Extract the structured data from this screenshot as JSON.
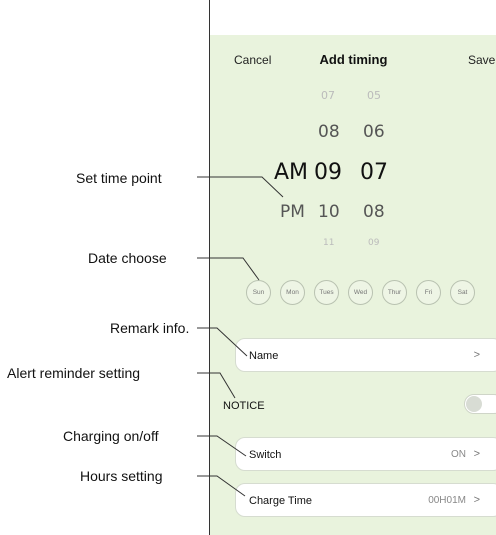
{
  "callouts": {
    "set_time_point": "Set time point",
    "date_choose": "Date choose",
    "remark_info": "Remark info.",
    "alert_reminder": "Alert reminder setting",
    "charging_onoff": "Charging on/off",
    "hours_setting": "Hours setting"
  },
  "header": {
    "cancel": "Cancel",
    "title": "Add timing",
    "save": "Save"
  },
  "picker": {
    "hours": [
      "07",
      "08",
      "09",
      "10",
      "11"
    ],
    "minutes": [
      "05",
      "06",
      "07",
      "08",
      "09"
    ],
    "periods": [
      "AM",
      "PM"
    ],
    "selected_period": "AM",
    "selected_hour": "09",
    "selected_minute": "07"
  },
  "days": [
    "Sun",
    "Mon",
    "Tues",
    "Wed",
    "Thur",
    "Fri",
    "Sat"
  ],
  "rows": {
    "name": {
      "label": "Name",
      "chevron": ">"
    },
    "notice": {
      "label": "NOTICE",
      "toggle_on": false
    },
    "switch": {
      "label": "Switch",
      "value": "ON",
      "chevron": ">"
    },
    "charge_time": {
      "label": "Charge Time",
      "value": "00H01M",
      "chevron": ">"
    }
  },
  "colors": {
    "background": "#e9f3dd",
    "card": "#ffffff"
  }
}
